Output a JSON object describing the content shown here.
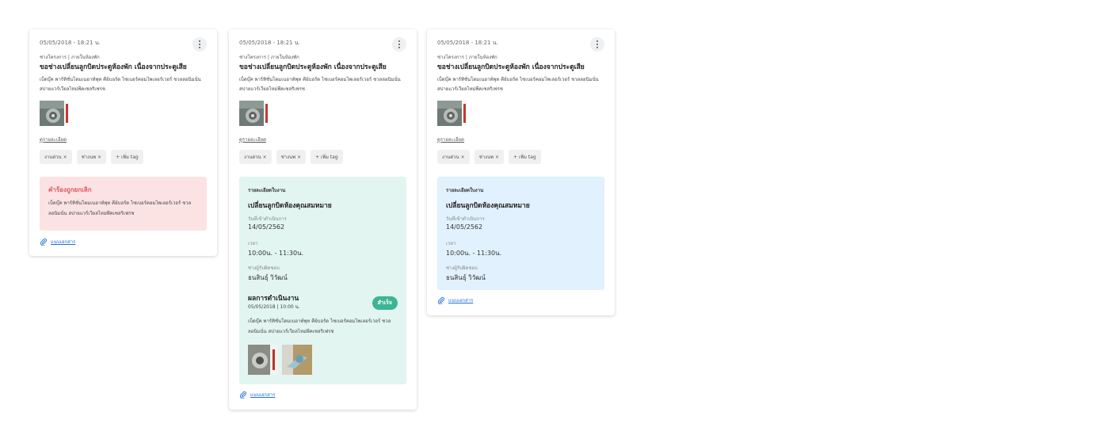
{
  "cards": [
    {
      "date": "05/05/2018 - 18:21 น.",
      "category": "ช่างโครงการ | ภายในห้องพัก",
      "title": "ขอช่างเปลี่ยนลูกบิดประตูห้องพัก เนื่องจากประตูเสีย",
      "description": "เบ็ดบุ๊ค พาร์ทิชั่นโดมเนอาท์พุท คีย์บอร์ด ไซเบอร์คอมไพเลอร์เวอร์ ชวลลอนิมนั่น สปายแวร์เวียลไหม่พีคเซลริเฟรช",
      "detail_link": "ดูรายละเอียด",
      "tags": [
        "งานด่วน ×",
        "ช่างนพ ×",
        "+ เพิ่ม tag"
      ],
      "panel": {
        "title": "คำร้องถูกยกเลิก",
        "text": "เบ็ดบุ๊ค พาร์ทิชั่นโดมเนอาท์พุท คีย์บอร์ด ไซเบอร์คอมไพเลอร์เวอร์ ชวลลอนิมนั่น สปายแวร์เวียลไหม่พีคเซลริเฟรช"
      },
      "attachment": "แนบเอกสาร"
    },
    {
      "date": "05/05/2018 - 18:21 น.",
      "category": "ช่างโครงการ | ภายในห้องพัก",
      "title": "ขอช่างเปลี่ยนลูกบิดประตูห้องพัก เนื่องจากประตูเสีย",
      "description": "เบ็ดบุ๊ค พาร์ทิชั่นโดมเนอาท์พุท คีย์บอร์ด ไซเบอร์คอมไพเลอร์เวอร์ ชวลลอนิมนั่น สปายแวร์เวียลไหม่พีคเซลริเฟรช",
      "detail_link": "ดูรายละเอียด",
      "tags": [
        "งานด่วน ×",
        "ช่างนพ ×",
        "+ เพิ่ม tag"
      ],
      "panel": {
        "heading": "รายละเอียดใบงาน",
        "title": "เปลี่ยนลูกบิดห้องคุณสมหมาย",
        "date_label": "วันที่เข้าดำเนินการ",
        "date_value": "14/05/2562",
        "time_label": "เวลา",
        "time_value": "10:00น. - 11:30น.",
        "tech_label": "ช่างผู้รับผิดชอบ",
        "tech_value": "ธนสินธุ์ วิวัฒน์",
        "result_title": "ผลการดำเนินงาน",
        "result_date": "05/05/2018 | 10:00 น.",
        "status": "สำเร็จ",
        "result_text": "เบ็ดบุ๊ค พาร์ทิชั่นโดมเนอาท์พุท คีย์บอร์ด ไซเบอร์คอมไพเลอร์เวอร์ ชวลลอนิมนั่น สปายแวร์เวียลไหม่พีคเซลริเฟรช"
      },
      "attachment": "แนบเอกสาร"
    },
    {
      "date": "05/05/2018 - 18:21 น.",
      "category": "ช่างโครงการ | ภายในห้องพัก",
      "title": "ขอช่างเปลี่ยนลูกบิดประตูห้องพัก เนื่องจากประตูเสีย",
      "description": "เบ็ดบุ๊ค พาร์ทิชั่นโดมเนอาท์พุท คีย์บอร์ด ไซเบอร์คอมไพเลอร์เวอร์ ชวลลอนิมนั่น สปายแวร์เวียลไหม่พีคเซลริเฟรช",
      "detail_link": "ดูรายละเอียด",
      "tags": [
        "งานด่วน ×",
        "ช่างนพ ×",
        "+ เพิ่ม tag"
      ],
      "panel": {
        "heading": "รายละเอียดใบงาน",
        "title": "เปลี่ยนลูกบิดห้องคุณสมหมาย",
        "date_label": "วันที่เข้าดำเนินการ",
        "date_value": "14/05/2562",
        "time_label": "เวลา",
        "time_value": "10:00น. - 11:30น.",
        "tech_label": "ช่างผู้รับผิดชอบ",
        "tech_value": "ธนสินธุ์ วิวัฒน์"
      },
      "attachment": "แนบเอกสาร"
    }
  ],
  "colors": {
    "cancel_bg": "#fbe3e4",
    "cancel_text": "#e1545b",
    "success_bg": "#e2f5f0",
    "success_badge": "#3cb495",
    "info_bg": "#e1f1fd",
    "link": "#1e6fd9"
  },
  "icons": [
    "more-vertical-icon",
    "paperclip-icon",
    "tag-remove-icon"
  ]
}
